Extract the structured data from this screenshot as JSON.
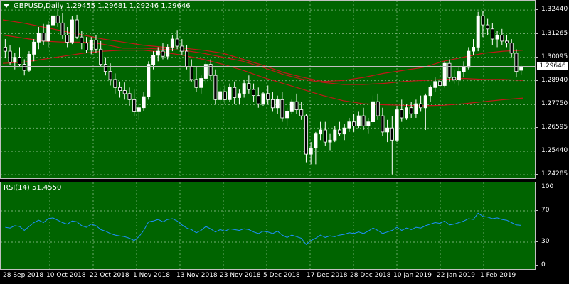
{
  "symbol_title": "GBPUSD,Daily  1.29455 1.29681 1.29246 1.29646",
  "rsi_title": "RSI(14) 51.4550",
  "current_price": "1.29646",
  "colors": {
    "background": "#006400",
    "grid": "#8fbf8f",
    "bull_candle": "#ffffff",
    "bear_candle": "#000000",
    "wick": "#ffffff",
    "ma": "#c01818",
    "rsi_line": "#1e90ff",
    "text": "#ffffff"
  },
  "chart_data": [
    {
      "type": "candlestick",
      "title": "GBPUSD,Daily",
      "ohlc_last": {
        "open": 1.29455,
        "high": 1.29681,
        "low": 1.29246,
        "close": 1.29646
      },
      "y_ticks": [
        "1.32440",
        "1.31265",
        "1.30095",
        "1.28940",
        "1.27750",
        "1.26595",
        "1.25440",
        "1.24285"
      ],
      "ylim": [
        1.2404,
        1.329
      ],
      "x_tick_labels": [
        "28 Sep 2018",
        "10 Oct 2018",
        "22 Oct 2018",
        "1 Nov 2018",
        "13 Nov 2018",
        "23 Nov 2018",
        "5 Dec 2018",
        "17 Dec 2018",
        "28 Dec 2018",
        "10 Jan 2019",
        "22 Jan 2019",
        "1 Feb 2019"
      ],
      "candles": [
        [
          1.306,
          1.31,
          1.3005,
          1.304
        ],
        [
          1.304,
          1.307,
          1.297,
          1.2985
        ],
        [
          1.2985,
          1.303,
          1.295,
          1.301
        ],
        [
          1.301,
          1.306,
          1.296,
          1.2975
        ],
        [
          1.2975,
          1.3,
          1.292,
          1.2945
        ],
        [
          1.2945,
          1.304,
          1.2935,
          1.3025
        ],
        [
          1.3025,
          1.31,
          1.299,
          1.3085
        ],
        [
          1.3085,
          1.316,
          1.305,
          1.313
        ],
        [
          1.313,
          1.3175,
          1.307,
          1.309
        ],
        [
          1.309,
          1.319,
          1.306,
          1.317
        ],
        [
          1.317,
          1.3265,
          1.315,
          1.3215
        ],
        [
          1.3215,
          1.325,
          1.316,
          1.318
        ],
        [
          1.318,
          1.323,
          1.31,
          1.312
        ],
        [
          1.312,
          1.316,
          1.306,
          1.3085
        ],
        [
          1.3085,
          1.3215,
          1.3075,
          1.3195
        ],
        [
          1.3195,
          1.322,
          1.31,
          1.311
        ],
        [
          1.311,
          1.314,
          1.305,
          1.308
        ],
        [
          1.308,
          1.311,
          1.303,
          1.3045
        ],
        [
          1.3045,
          1.311,
          1.3025,
          1.3095
        ],
        [
          1.3095,
          1.312,
          1.303,
          1.305
        ],
        [
          1.305,
          1.309,
          1.296,
          1.2975
        ],
        [
          1.2975,
          1.301,
          1.292,
          1.294
        ],
        [
          1.294,
          1.298,
          1.287,
          1.29
        ],
        [
          1.29,
          1.293,
          1.283,
          1.286
        ],
        [
          1.286,
          1.289,
          1.281,
          1.2845
        ],
        [
          1.2845,
          1.2885,
          1.28,
          1.283
        ],
        [
          1.283,
          1.286,
          1.277,
          1.28
        ],
        [
          1.28,
          1.285,
          1.272,
          1.274
        ],
        [
          1.274,
          1.278,
          1.27,
          1.276
        ],
        [
          1.276,
          1.284,
          1.2745,
          1.2815
        ],
        [
          1.2815,
          1.299,
          1.28,
          1.2975
        ],
        [
          1.2975,
          1.304,
          1.295,
          1.302
        ],
        [
          1.302,
          1.306,
          1.299,
          1.304
        ],
        [
          1.304,
          1.308,
          1.3,
          1.3015
        ],
        [
          1.3015,
          1.3075,
          1.3,
          1.306
        ],
        [
          1.306,
          1.312,
          1.304,
          1.31
        ],
        [
          1.31,
          1.3145,
          1.305,
          1.3065
        ],
        [
          1.3065,
          1.31,
          1.302,
          1.304
        ],
        [
          1.304,
          1.307,
          1.295,
          1.2965
        ],
        [
          1.2965,
          1.3,
          1.289,
          1.29
        ],
        [
          1.29,
          1.296,
          1.284,
          1.286
        ],
        [
          1.286,
          1.292,
          1.283,
          1.2905
        ],
        [
          1.2905,
          1.299,
          1.288,
          1.2975
        ],
        [
          1.2975,
          1.3,
          1.29,
          1.292
        ],
        [
          1.292,
          1.295,
          1.278,
          1.28
        ],
        [
          1.28,
          1.286,
          1.276,
          1.284
        ],
        [
          1.284,
          1.287,
          1.278,
          1.28
        ],
        [
          1.28,
          1.288,
          1.279,
          1.286
        ],
        [
          1.286,
          1.289,
          1.278,
          1.281
        ],
        [
          1.281,
          1.285,
          1.278,
          1.283
        ],
        [
          1.283,
          1.29,
          1.281,
          1.288
        ],
        [
          1.288,
          1.292,
          1.283,
          1.285
        ],
        [
          1.285,
          1.288,
          1.279,
          1.282
        ],
        [
          1.282,
          1.286,
          1.276,
          1.278
        ],
        [
          1.278,
          1.284,
          1.277,
          1.283
        ],
        [
          1.283,
          1.287,
          1.278,
          1.28
        ],
        [
          1.28,
          1.284,
          1.274,
          1.276
        ],
        [
          1.276,
          1.282,
          1.273,
          1.28
        ],
        [
          1.28,
          1.284,
          1.269,
          1.271
        ],
        [
          1.271,
          1.276,
          1.267,
          1.274
        ],
        [
          1.274,
          1.28,
          1.273,
          1.279
        ],
        [
          1.279,
          1.283,
          1.273,
          1.275
        ],
        [
          1.275,
          1.279,
          1.27,
          1.272
        ],
        [
          1.272,
          1.273,
          1.249,
          1.253
        ],
        [
          1.253,
          1.259,
          1.248,
          1.256
        ],
        [
          1.256,
          1.264,
          1.248,
          1.263
        ],
        [
          1.263,
          1.269,
          1.26,
          1.265
        ],
        [
          1.265,
          1.269,
          1.257,
          1.259
        ],
        [
          1.259,
          1.263,
          1.255,
          1.26
        ],
        [
          1.26,
          1.267,
          1.259,
          1.265
        ],
        [
          1.265,
          1.269,
          1.262,
          1.263
        ],
        [
          1.263,
          1.268,
          1.26,
          1.266
        ],
        [
          1.266,
          1.271,
          1.264,
          1.269
        ],
        [
          1.269,
          1.273,
          1.264,
          1.267
        ],
        [
          1.267,
          1.274,
          1.266,
          1.272
        ],
        [
          1.272,
          1.276,
          1.265,
          1.267
        ],
        [
          1.267,
          1.271,
          1.263,
          1.269
        ],
        [
          1.269,
          1.282,
          1.268,
          1.279
        ],
        [
          1.279,
          1.283,
          1.27,
          1.272
        ],
        [
          1.272,
          1.276,
          1.262,
          1.264
        ],
        [
          1.264,
          1.27,
          1.259,
          1.266
        ],
        [
          1.266,
          1.272,
          1.243,
          1.26
        ],
        [
          1.26,
          1.277,
          1.259,
          1.275
        ],
        [
          1.275,
          1.28,
          1.269,
          1.271
        ],
        [
          1.271,
          1.278,
          1.27,
          1.276
        ],
        [
          1.276,
          1.279,
          1.271,
          1.273
        ],
        [
          1.273,
          1.28,
          1.271,
          1.278
        ],
        [
          1.278,
          1.282,
          1.274,
          1.276
        ],
        [
          1.276,
          1.283,
          1.265,
          1.282
        ],
        [
          1.282,
          1.287,
          1.279,
          1.286
        ],
        [
          1.286,
          1.291,
          1.284,
          1.289
        ],
        [
          1.289,
          1.292,
          1.285,
          1.287
        ],
        [
          1.287,
          1.299,
          1.286,
          1.298
        ],
        [
          1.298,
          1.3,
          1.289,
          1.291
        ],
        [
          1.291,
          1.295,
          1.288,
          1.29
        ],
        [
          1.29,
          1.296,
          1.287,
          1.294
        ],
        [
          1.294,
          1.299,
          1.291,
          1.296
        ],
        [
          1.296,
          1.306,
          1.295,
          1.304
        ],
        [
          1.304,
          1.31,
          1.302,
          1.306
        ],
        [
          1.306,
          1.3235,
          1.304,
          1.3215
        ],
        [
          1.3215,
          1.324,
          1.311,
          1.317
        ],
        [
          1.317,
          1.32,
          1.312,
          1.315
        ],
        [
          1.315,
          1.318,
          1.307,
          1.31
        ],
        [
          1.31,
          1.314,
          1.306,
          1.312
        ],
        [
          1.312,
          1.315,
          1.307,
          1.309
        ],
        [
          1.309,
          1.312,
          1.306,
          1.308
        ],
        [
          1.308,
          1.31,
          1.301,
          1.303
        ],
        [
          1.303,
          1.305,
          1.291,
          1.294
        ],
        [
          1.29455,
          1.29681,
          1.29246,
          1.29646
        ]
      ],
      "moving_averages": [
        {
          "values": [
            1.3195,
            1.318,
            1.316,
            1.314,
            1.312,
            1.31,
            1.3085,
            1.307,
            1.306,
            1.3055,
            1.3045,
            1.303,
            1.3,
            1.297,
            1.2935,
            1.291,
            1.289,
            1.2895,
            1.291,
            1.293,
            1.2945,
            1.296,
            1.299,
            1.301,
            1.303,
            1.304,
            1.3045
          ]
        },
        {
          "values": [
            1.312,
            1.3105,
            1.309,
            1.3085,
            1.3085,
            1.3075,
            1.3055,
            1.3055,
            1.305,
            1.3045,
            1.303,
            1.301,
            1.299,
            1.296,
            1.2925,
            1.29,
            1.2885,
            1.2875,
            1.2875,
            1.288,
            1.289,
            1.2895,
            1.29,
            1.2905,
            1.29,
            1.29,
            1.2895
          ]
        },
        {
          "values": [
            1.298,
            1.2985,
            1.3,
            1.3015,
            1.303,
            1.304,
            1.3045,
            1.3045,
            1.3035,
            1.302,
            1.3,
            1.2975,
            1.2945,
            1.291,
            1.288,
            1.285,
            1.282,
            1.2795,
            1.278,
            1.2775,
            1.2772,
            1.277,
            1.2772,
            1.278,
            1.279,
            1.28,
            1.2808
          ]
        }
      ]
    },
    {
      "type": "line",
      "title": "RSI(14) 51.4550",
      "y_ticks": [
        "100",
        "70",
        "30",
        "0"
      ],
      "ylim": [
        0,
        100
      ],
      "values": [
        49,
        48,
        51,
        50,
        45,
        50,
        55,
        58,
        55,
        60,
        61,
        58,
        55,
        53,
        57,
        56,
        51,
        49,
        53,
        51,
        46,
        44,
        41,
        39,
        38,
        37,
        35,
        32,
        37,
        45,
        56,
        57,
        59,
        56,
        59,
        60,
        57,
        52,
        48,
        46,
        42,
        45,
        50,
        47,
        43,
        46,
        44,
        47,
        46,
        45,
        47,
        46,
        43,
        41,
        44,
        43,
        41,
        44,
        39,
        36,
        39,
        37,
        35,
        27,
        32,
        35,
        39,
        36,
        38,
        37,
        39,
        40,
        42,
        41,
        43,
        41,
        44,
        48,
        45,
        41,
        43,
        45,
        49,
        45,
        48,
        46,
        49,
        48,
        51,
        53,
        55,
        54,
        57,
        52,
        53,
        55,
        57,
        60,
        59,
        67,
        63,
        62,
        60,
        61,
        59,
        58,
        55,
        52,
        51.455
      ]
    }
  ]
}
